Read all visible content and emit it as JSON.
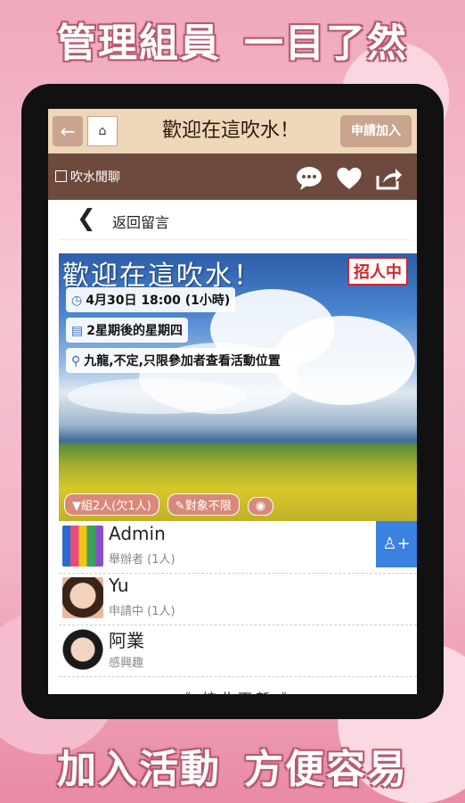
{
  "headlines": {
    "top": "管理組員 一目了然",
    "top_a": "管理組員",
    "top_b": "一目了然",
    "bottom_a": "加入活動",
    "bottom_b": "方便容易"
  },
  "topbar": {
    "title": "歡迎在這吹水！",
    "apply_label": "申請加入",
    "back_icon": "back-arrow-icon",
    "home_icon": "home-icon"
  },
  "subbar": {
    "label": "吹水閒聊"
  },
  "backrow": {
    "label": "返回留言"
  },
  "event": {
    "title": "歡迎在這吹水！",
    "status_badge": "招人中",
    "datetime": "4月30日 18:00 (1小時)",
    "recurrence": "2星期後的星期四",
    "location": "九龍,不定,只限參加者查看活動位置",
    "tags": [
      "組2人(欠1人)",
      "對象不限"
    ]
  },
  "members": [
    {
      "name": "Admin",
      "role": "舉辦者 (1人)"
    },
    {
      "name": "Yu",
      "role": "申請中 (1人)"
    },
    {
      "name": "阿業",
      "role": "感興趣"
    }
  ],
  "more_label": "《 按此更新 》"
}
